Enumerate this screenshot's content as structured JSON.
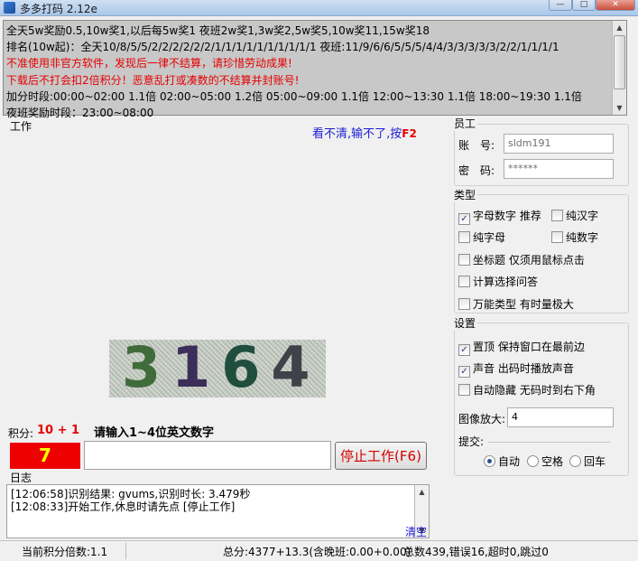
{
  "window": {
    "title": "多多打码 2.12e"
  },
  "notice": {
    "lines": [
      "全天5w奖励0.5,10w奖1,以后每5w奖1 夜班2w奖1,3w奖2,5w奖5,10w奖11,15w奖18",
      "排名(10w起)：全天10/8/5/5/2/2/2/2/2/2/1/1/1/1/1/1/1/1/1/1 夜班:11/9/6/6/5/5/5/4/4/3/3/3/3/3/2/2/1/1/1/1",
      "不准使用非官方软件，发现后一律不结算，请珍惜劳动成果!",
      "下载后不打会扣2倍积分！恶意乱打或凑数的不结算并封账号!",
      "加分时段:00:00~02:00 1.1倍  02:00~05:00 1.2倍  05:00~09:00 1.1倍  12:00~13:30 1.1倍  18:00~19:30 1.1倍",
      "夜班奖励时段：23:00~08:00"
    ],
    "red_color": "#e60000"
  },
  "work": {
    "label": "工作",
    "blurry_link": "看不清,输不了,按",
    "blurry_key": "F2",
    "captcha_digits": [
      "3",
      "1",
      "6",
      "4"
    ],
    "score_label": "积分:",
    "score_value": "10 + 1",
    "prompt": "请输入1~4位英文数字",
    "countdown": "7",
    "answer_value": "",
    "stop_button": "停止工作(F6)"
  },
  "log": {
    "label": "日志",
    "lines": [
      "[12:06:58]识别结果: gvums,识别时长: 3.479秒",
      "[12:08:33]开始工作,休息时请先点 [停止工作]"
    ],
    "clear": "清空"
  },
  "employee": {
    "title": "员工",
    "account_label": "账　号:",
    "account_value": "sldm191",
    "password_label": "密　码:",
    "password_value": "******"
  },
  "type": {
    "title": "类型",
    "options": [
      {
        "label": "字母数字 推荐",
        "checked": true
      },
      {
        "label": "纯汉字",
        "checked": false
      },
      {
        "label": "纯字母",
        "checked": false
      },
      {
        "label": "纯数字",
        "checked": false
      },
      {
        "label": "坐标题 仅须用鼠标点击",
        "checked": false
      },
      {
        "label": "计算选择问答",
        "checked": false
      },
      {
        "label": "万能类型 有时量极大",
        "checked": false
      }
    ]
  },
  "settings": {
    "title": "设置",
    "options": [
      {
        "label": "置顶 保持窗口在最前边",
        "checked": true
      },
      {
        "label": "声音 出码时播放声音",
        "checked": true
      },
      {
        "label": "自动隐藏 无码时到右下角",
        "checked": false
      }
    ],
    "zoom_label": "图像放大:",
    "zoom_value": "4",
    "submit_label": "提交:",
    "submit_options": [
      {
        "label": "自动",
        "selected": true
      },
      {
        "label": "空格",
        "selected": false
      },
      {
        "label": "回车",
        "selected": false
      }
    ]
  },
  "status": {
    "multiplier": "当前积分倍数:1.1",
    "total": "总分:4377+13.3(含晚班:0.00+0.00)",
    "stats": "总数439,错误16,超时0,跳过0"
  }
}
